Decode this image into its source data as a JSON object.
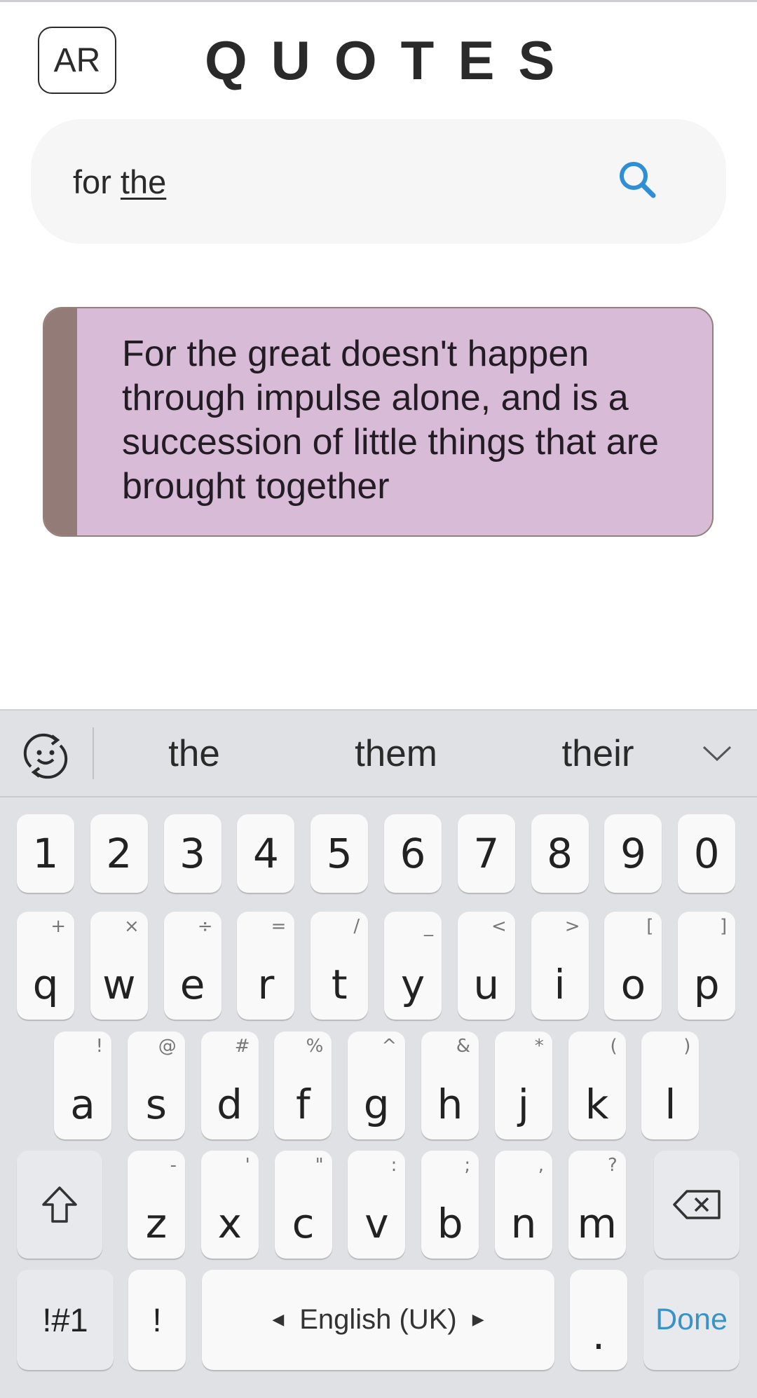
{
  "header": {
    "lang_button": "AR",
    "title": "QUOTES"
  },
  "search": {
    "typed_prefix": "for ",
    "composing_word": "the",
    "icon": "search-icon"
  },
  "quote": {
    "text": "For the great doesn't happen through impulse alone, and is a succession of little things that are brought together"
  },
  "keyboard": {
    "suggestions": [
      "the",
      "them",
      "their"
    ],
    "numbers": [
      "1",
      "2",
      "3",
      "4",
      "5",
      "6",
      "7",
      "8",
      "9",
      "0"
    ],
    "row_q": [
      {
        "main": "q",
        "alt": "+"
      },
      {
        "main": "w",
        "alt": "×"
      },
      {
        "main": "e",
        "alt": "÷"
      },
      {
        "main": "r",
        "alt": "="
      },
      {
        "main": "t",
        "alt": "/"
      },
      {
        "main": "y",
        "alt": "_"
      },
      {
        "main": "u",
        "alt": "<"
      },
      {
        "main": "i",
        "alt": ">"
      },
      {
        "main": "o",
        "alt": "["
      },
      {
        "main": "p",
        "alt": "]"
      }
    ],
    "row_a": [
      {
        "main": "a",
        "alt": "!"
      },
      {
        "main": "s",
        "alt": "@"
      },
      {
        "main": "d",
        "alt": "#"
      },
      {
        "main": "f",
        "alt": "%"
      },
      {
        "main": "g",
        "alt": "^"
      },
      {
        "main": "h",
        "alt": "&"
      },
      {
        "main": "j",
        "alt": "*"
      },
      {
        "main": "k",
        "alt": "("
      },
      {
        "main": "l",
        "alt": ")"
      }
    ],
    "row_z": [
      {
        "main": "z",
        "alt": "-"
      },
      {
        "main": "x",
        "alt": "'"
      },
      {
        "main": "c",
        "alt": "\""
      },
      {
        "main": "v",
        "alt": ":"
      },
      {
        "main": "b",
        "alt": ";"
      },
      {
        "main": "n",
        "alt": ","
      },
      {
        "main": "m",
        "alt": "?"
      }
    ],
    "symbols_key": "!#1",
    "exclaim_key": "!",
    "space_label": "English (UK)",
    "period_key": ".",
    "done_key": "Done"
  },
  "colors": {
    "accent": "#3a93c8",
    "card_bg": "#d7bbd7",
    "card_bar": "#937c78",
    "keyboard_bg": "#e0e1e5"
  }
}
